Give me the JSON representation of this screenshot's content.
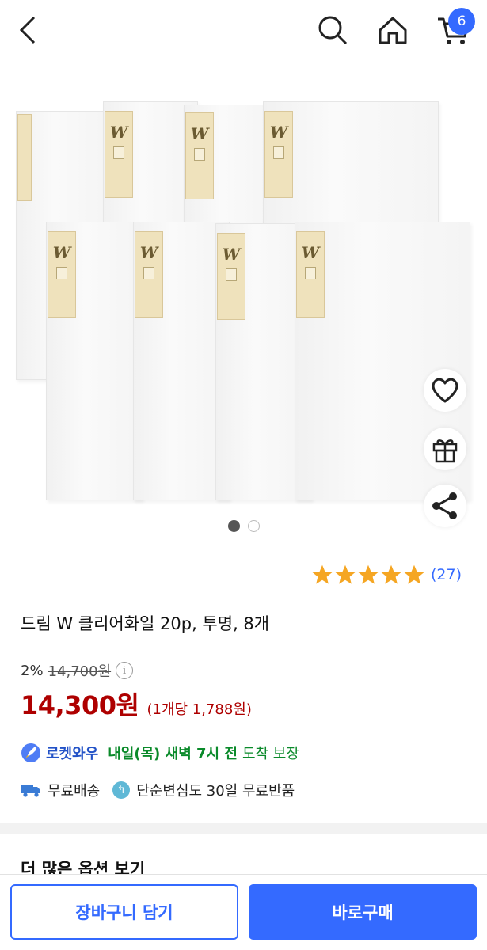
{
  "header": {
    "back_icon": "chevron-left-icon",
    "search_icon": "search-icon",
    "home_icon": "home-icon",
    "cart_icon": "cart-icon",
    "cart_count": "6"
  },
  "gallery": {
    "binder_logo": "W",
    "page_count": 2,
    "active_index": 0,
    "side_actions": [
      "heart-icon",
      "gift-icon",
      "share-icon"
    ]
  },
  "rating": {
    "stars": 5,
    "review_count": "(27)"
  },
  "product": {
    "title": "드림 W 클리어화일 20p, 투명, 8개"
  },
  "price": {
    "discount": "2%",
    "original": "14,700원",
    "current": "14,300원",
    "unit": "(1개당 1,788원)"
  },
  "delivery": {
    "badge": "로켓와우",
    "date": "내일(목) 새벽 7시 전",
    "guarantee": "도착 보장"
  },
  "benefits": {
    "shipping": "무료배송",
    "returns": "단순변심도 30일 무료반품"
  },
  "more_options": "더 많은 옵션 보기",
  "bottom": {
    "cart_label": "장바구니 담기",
    "buy_label": "바로구매"
  },
  "colors": {
    "accent": "#346aff",
    "price": "#ae0000",
    "delivery_green": "#0a8a2a",
    "star": "#f5a623"
  }
}
